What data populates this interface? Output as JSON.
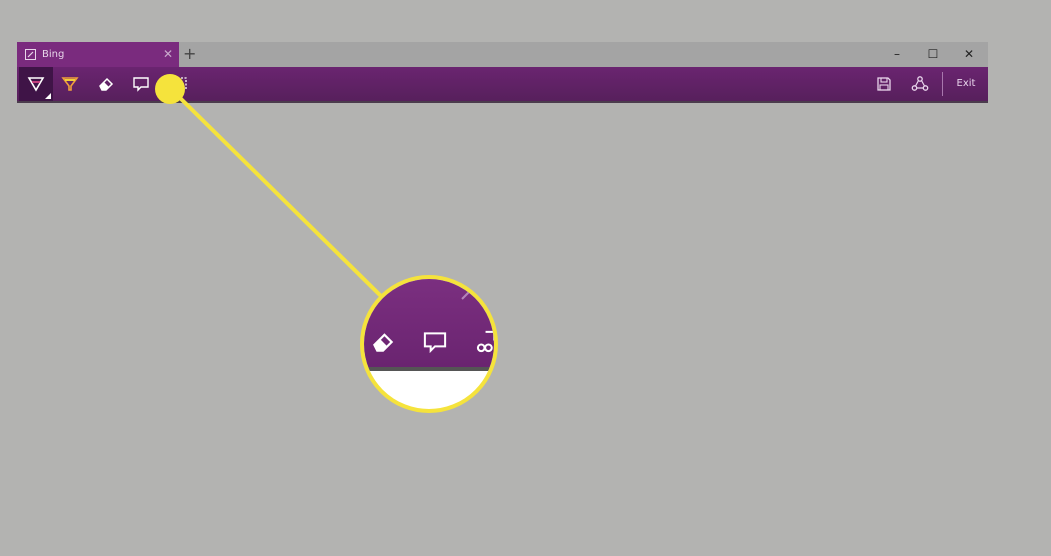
{
  "browser": {
    "tab": {
      "title": "Bing",
      "close_glyph": "✕",
      "icon": "note-icon"
    },
    "new_tab_glyph": "+",
    "window_controls": {
      "minimize_glyph": "–",
      "maximize_glyph": "☐",
      "close_glyph": "✕"
    }
  },
  "toolbar": {
    "tools": [
      {
        "name": "ballpoint-pen",
        "icon": "pen-icon",
        "active": true
      },
      {
        "name": "highlighter",
        "icon": "highlighter-icon",
        "active": false
      },
      {
        "name": "eraser",
        "icon": "eraser-icon",
        "active": false
      },
      {
        "name": "add-note",
        "icon": "comment-icon",
        "active": false
      },
      {
        "name": "clip",
        "icon": "clip-icon",
        "active": false
      }
    ],
    "right_tools": [
      {
        "name": "save",
        "icon": "save-icon"
      },
      {
        "name": "share",
        "icon": "share-icon"
      }
    ],
    "exit_label": "Exit"
  },
  "colors": {
    "background": "#b3b3b1",
    "accent_purple": "#6a2470",
    "callout_yellow": "#f5e33c"
  },
  "callout": {
    "magnified_tools": [
      "eraser-icon",
      "comment-icon",
      "clip-icon"
    ]
  }
}
